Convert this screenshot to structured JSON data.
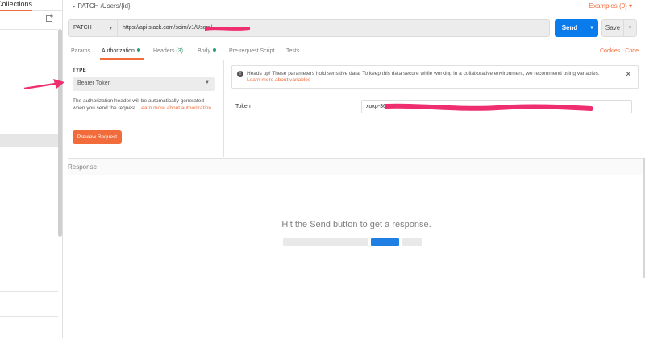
{
  "sidebar": {
    "tab_label": "Collections",
    "new_collection_icon": "new-collection-icon"
  },
  "request": {
    "title": "PATCH /Users/{id}",
    "examples_label": "Examples (0)",
    "method": "PATCH",
    "url": "https://api.slack.com/scim/v1/Users/",
    "send_label": "Send",
    "save_label": "Save"
  },
  "tabs": {
    "params": "Params",
    "authorization": "Authorization",
    "headers": "Headers",
    "headers_count": "(3)",
    "body": "Body",
    "pre_request": "Pre-request Script",
    "tests": "Tests",
    "cookies": "Cookies",
    "code": "Code"
  },
  "auth": {
    "type_label": "TYPE",
    "type_value": "Bearer Token",
    "help_text": "The authorization header will be automatically generated when you send the request.",
    "help_link": "Learn more about authorization",
    "preview_label": "Preview Request",
    "warning_text": "Heads up! These parameters hold sensitive data. To keep this data secure while working in a collaborative environment, we recommend using variables.",
    "warning_link": "Learn more about variables",
    "token_label": "Token",
    "token_value": "xoxp-36"
  },
  "response": {
    "label": "Response",
    "empty_text": "Hit the Send button to get a response."
  },
  "colors": {
    "accent": "#f26b3a",
    "primary": "#097bed",
    "redaction": "#ee2e6e"
  }
}
